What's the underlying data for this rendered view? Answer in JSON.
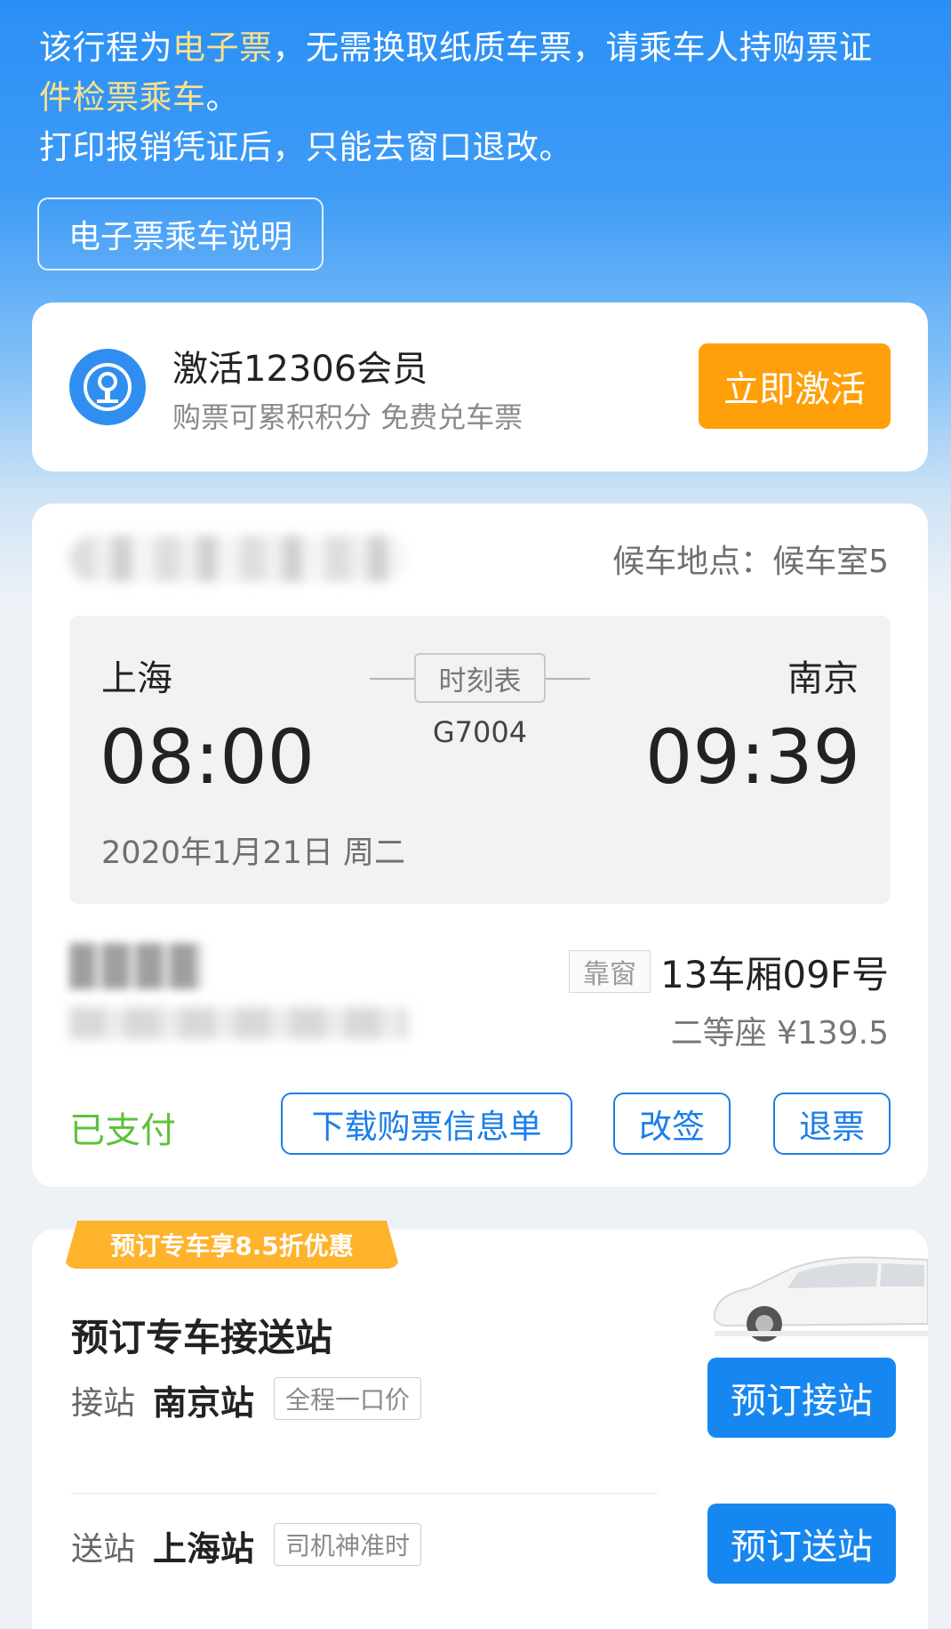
{
  "notice": {
    "line1_a": "该行程为",
    "line1_hl": "电子票",
    "line1_b": "，无需换取纸质车票，请乘车人持购票证",
    "line2_hl": "件检票乘车",
    "line2_b": "。",
    "line3": "打印报销凭证后，只能去窗口退改。",
    "guide_button": "电子票乘车说明"
  },
  "member": {
    "title": "激活12306会员",
    "subtitle": "购票可累积积分 免费兑车票",
    "activate_button": "立即激活"
  },
  "ticket": {
    "waiting_room": "候车地点：候车室5",
    "from_city": "上海",
    "to_city": "南京",
    "departure_time": "08:00",
    "arrival_time": "09:39",
    "train_no": "G7004",
    "schedule_button": "时刻表",
    "date": "2020年1月21日 周二",
    "window_tag": "靠窗",
    "seat": "13车厢09F号",
    "price": "二等座 ¥139.5",
    "status": "已支付",
    "buttons": {
      "download": "下载购票信息单",
      "change": "改签",
      "refund": "退票"
    }
  },
  "car_service": {
    "promo": "预订专车享8.5折优惠",
    "title": "预订专车接送站",
    "pickup": {
      "label": "接站",
      "station": "南京站",
      "tag": "全程一口价",
      "button": "预订接站"
    },
    "dropoff": {
      "label": "送站",
      "station": "上海站",
      "tag": "司机神准时",
      "button": "预订送站"
    }
  },
  "colors": {
    "primary_blue": "#1687f0",
    "activate_orange": "#ff9f0a",
    "paid_green": "#5cc23b",
    "highlight_yellow": "#ffe08a"
  }
}
